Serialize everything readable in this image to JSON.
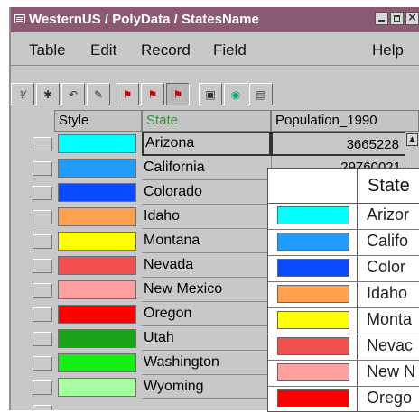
{
  "window": {
    "title": "WesternUS / PolyData / StatesName"
  },
  "menu": {
    "items": [
      "Table",
      "Edit",
      "Record",
      "Field"
    ],
    "help": "Help"
  },
  "toolbar": {
    "buttons": [
      "row-number-icon",
      "sparkle-icon",
      "undo-icon",
      "pencil-icon",
      "select-icon",
      "select-multiple-icon",
      "highlight-icon",
      "save-icon",
      "globe-icon",
      "edit-sheet-icon"
    ]
  },
  "columns": {
    "style": "Style",
    "state": "State",
    "population": "Population_1990"
  },
  "rows": [
    {
      "state": "Arizona",
      "population": "3665228",
      "color": "#00ffff"
    },
    {
      "state": "California",
      "population": "29760021",
      "color": "#1e9cff"
    },
    {
      "state": "Colorado",
      "population": "",
      "color": "#0a4bff"
    },
    {
      "state": "Idaho",
      "population": "",
      "color": "#ffa050"
    },
    {
      "state": "Montana",
      "population": "",
      "color": "#ffff00"
    },
    {
      "state": "Nevada",
      "population": "",
      "color": "#f2524f"
    },
    {
      "state": "New Mexico",
      "population": "",
      "color": "#ffa0a0"
    },
    {
      "state": "Oregon",
      "population": "",
      "color": "#ff0000"
    },
    {
      "state": "Utah",
      "population": "",
      "color": "#1aa31a"
    },
    {
      "state": "Washington",
      "population": "",
      "color": "#14f014"
    },
    {
      "state": "Wyoming",
      "population": "",
      "color": "#a8ffa0"
    }
  ],
  "legend": {
    "title": "State",
    "items": [
      {
        "label": "Arizor",
        "color": "#00ffff"
      },
      {
        "label": "Califo",
        "color": "#1e9cff"
      },
      {
        "label": "Color",
        "color": "#0a4bff"
      },
      {
        "label": "Idaho",
        "color": "#ffa050"
      },
      {
        "label": "Monta",
        "color": "#ffff00"
      },
      {
        "label": "Nevac",
        "color": "#f2524f"
      },
      {
        "label": "New N",
        "color": "#ffa0a0"
      },
      {
        "label": "Orego",
        "color": "#ff0000"
      }
    ]
  }
}
